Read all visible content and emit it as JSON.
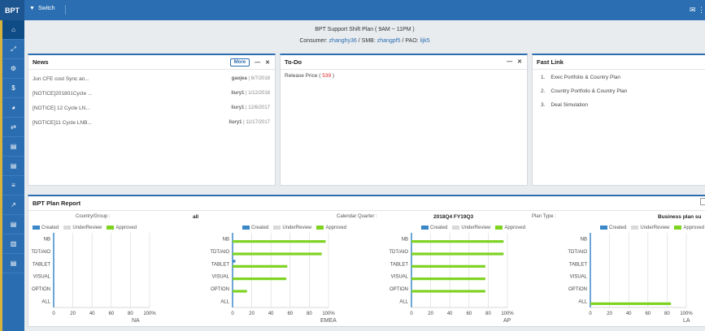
{
  "app": {
    "brand": "BPT",
    "switch_label": "Switch"
  },
  "sidebar": {
    "items": [
      {
        "icon": "home-icon",
        "glyph": "⌂",
        "active": true
      },
      {
        "icon": "resize-icon",
        "glyph": "⤢",
        "active": false
      },
      {
        "icon": "gear-icon",
        "glyph": "⚙",
        "active": false
      },
      {
        "icon": "dollar-icon",
        "glyph": "$",
        "active": false
      },
      {
        "icon": "pie-chart-icon",
        "glyph": "◕",
        "active": false
      },
      {
        "icon": "shuffle-icon",
        "glyph": "⇄",
        "active": false
      },
      {
        "icon": "document-icon",
        "glyph": "▤",
        "active": false
      },
      {
        "icon": "document-icon",
        "glyph": "▤",
        "active": false
      },
      {
        "icon": "list-icon",
        "glyph": "≡",
        "active": false
      },
      {
        "icon": "line-chart-icon",
        "glyph": "↗",
        "active": false
      },
      {
        "icon": "document-icon",
        "glyph": "▤",
        "active": false
      },
      {
        "icon": "bar-chart-icon",
        "glyph": "▥",
        "active": false
      },
      {
        "icon": "document-icon",
        "glyph": "▤",
        "active": false
      }
    ]
  },
  "header": {
    "title": "BPT Support Shift Plan ( 9AM ~ 11PM )",
    "consumer_label": "Consumer:",
    "consumer": "zhanghy36",
    "smb_label": "/ SMB:",
    "smb": "zhangpf5",
    "pao_label": "/ PAO:",
    "pao": "lijk5"
  },
  "news": {
    "title": "News",
    "more_label": "More",
    "items": [
      {
        "title": "Jun CFE cost Sync an...",
        "author": "gaojea",
        "date": "6/7/2018"
      },
      {
        "title": "[NOTICE]201801Cycle ...",
        "author": "liury1",
        "date": "1/12/2018"
      },
      {
        "title": "[NOTICE] 12 Cycle LN...",
        "author": "liury1",
        "date": "12/6/2017"
      },
      {
        "title": "[NOTICE]11 Cycle LNB...",
        "author": "liury1",
        "date": "11/17/2017"
      }
    ]
  },
  "todo": {
    "title": "To-Do",
    "items": [
      {
        "label": "Release Price",
        "count": "539"
      }
    ]
  },
  "fastlink": {
    "title": "Fast Link",
    "items": [
      {
        "num": "1.",
        "label": "Exec Portfolio & Country Plan"
      },
      {
        "num": "2.",
        "label": "Country Portfolio & Country Plan"
      },
      {
        "num": "3.",
        "label": "Deal Simulation"
      }
    ]
  },
  "report": {
    "title": "BPT Plan Report",
    "filters": [
      {
        "label": "Country/Group :",
        "value": "all"
      },
      {
        "label": "Calendar Quarter :",
        "value": "2018Q4 FY19Q3"
      },
      {
        "label": "Plan Type :",
        "value": "Business plan su"
      }
    ],
    "legend": [
      {
        "label": "Created",
        "color": "#3a87c8"
      },
      {
        "label": "UnderReview",
        "color": "#d9d9d9"
      },
      {
        "label": "Approved",
        "color": "#7ed321"
      }
    ]
  },
  "chart_data": [
    {
      "type": "bar",
      "orientation": "horizontal",
      "region": "NA",
      "categories": [
        "NB",
        "TDT/AIO",
        "TABLET",
        "VISUAL",
        "OPTION",
        "ALL"
      ],
      "x_ticks": [
        "0",
        "20",
        "40",
        "60",
        "80",
        "100%"
      ],
      "xlim": [
        0,
        100
      ],
      "grid": true,
      "series": [
        {
          "name": "Created",
          "values": [
            0,
            0,
            0,
            0,
            0,
            0
          ]
        },
        {
          "name": "UnderReview",
          "values": [
            0,
            0,
            0,
            0,
            0,
            0
          ]
        },
        {
          "name": "Approved",
          "values": [
            0,
            0,
            0,
            0,
            0,
            0
          ]
        }
      ]
    },
    {
      "type": "bar",
      "orientation": "horizontal",
      "region": "EMEA",
      "categories": [
        "NB",
        "TDT/AIO",
        "TABLET",
        "VISUAL",
        "OPTION",
        "ALL"
      ],
      "x_ticks": [
        "0",
        "20",
        "40",
        "60",
        "80",
        "100%"
      ],
      "xlim": [
        0,
        100
      ],
      "grid": true,
      "series": [
        {
          "name": "Created",
          "values": [
            0,
            0,
            3,
            0,
            0,
            0
          ]
        },
        {
          "name": "UnderReview",
          "values": [
            0,
            0,
            0,
            0,
            0,
            0
          ]
        },
        {
          "name": "Approved",
          "values": [
            97,
            93,
            57,
            56,
            15,
            0
          ]
        }
      ]
    },
    {
      "type": "bar",
      "orientation": "horizontal",
      "region": "AP",
      "categories": [
        "NB",
        "TDT/AIO",
        "TABLET",
        "VISUAL",
        "OPTION",
        "ALL"
      ],
      "x_ticks": [
        "0",
        "20",
        "40",
        "60",
        "80",
        "100%"
      ],
      "xlim": [
        0,
        100
      ],
      "grid": true,
      "series": [
        {
          "name": "Created",
          "values": [
            0,
            0,
            0,
            0,
            0,
            0
          ]
        },
        {
          "name": "UnderReview",
          "values": [
            0,
            0,
            0,
            0,
            0,
            0
          ]
        },
        {
          "name": "Approved",
          "values": [
            96,
            96,
            77,
            77,
            77,
            0
          ]
        }
      ]
    },
    {
      "type": "bar",
      "orientation": "horizontal",
      "region": "LA",
      "categories": [
        "NB",
        "TDT/AIO",
        "TABLET",
        "VISUAL",
        "OPTION",
        "ALL"
      ],
      "x_ticks": [
        "0",
        "20",
        "40",
        "60",
        "80",
        "100%"
      ],
      "xlim": [
        0,
        100
      ],
      "grid": true,
      "series": [
        {
          "name": "Created",
          "values": [
            0,
            0,
            0,
            0,
            0,
            0
          ]
        },
        {
          "name": "UnderReview",
          "values": [
            0,
            0,
            0,
            0,
            0,
            0
          ]
        },
        {
          "name": "Approved",
          "values": [
            0,
            0,
            0,
            0,
            0,
            84
          ]
        }
      ]
    }
  ]
}
